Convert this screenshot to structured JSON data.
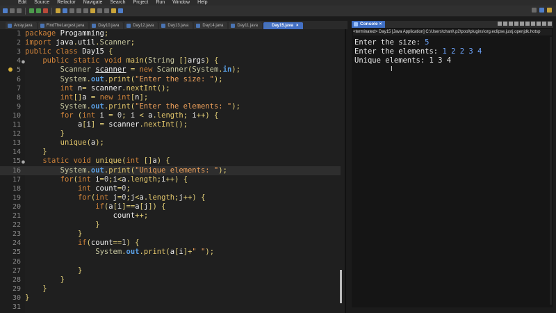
{
  "menu": [
    "Edit",
    "Source",
    "Refactor",
    "Navigate",
    "Search",
    "Project",
    "Run",
    "Window",
    "Help"
  ],
  "tabs": [
    "Array.java",
    "FindTheLargest.java",
    "Day10.java",
    "Day12.java",
    "Day13.java",
    "Day14.java",
    "Day11.java",
    "Day15.java"
  ],
  "active_tab_close": "×",
  "code_lines": [
    {
      "n": "1",
      "t": "package Progamming;"
    },
    {
      "n": "2",
      "t": "import java.util.Scanner;"
    },
    {
      "n": "3",
      "t": "public class Day15 {"
    },
    {
      "n": "4",
      "t": "    public static void main(String []args) {"
    },
    {
      "n": "5",
      "t": "        Scanner scanner = new Scanner(System.in);"
    },
    {
      "n": "6",
      "t": "        System.out.print(\"Enter the size: \");"
    },
    {
      "n": "7",
      "t": "        int n= scanner.nextInt();"
    },
    {
      "n": "8",
      "t": "        int[]a = new int[n];"
    },
    {
      "n": "9",
      "t": "        System.out.print(\"Enter the elements: \");"
    },
    {
      "n": "10",
      "t": "        for (int i = 0; i < a.length; i++) {"
    },
    {
      "n": "11",
      "t": "            a[i] = scanner.nextInt();"
    },
    {
      "n": "12",
      "t": "        }"
    },
    {
      "n": "13",
      "t": "        unique(a);"
    },
    {
      "n": "14",
      "t": "    }"
    },
    {
      "n": "15",
      "t": "    static void unique(int []a) {"
    },
    {
      "n": "16",
      "t": "        System.out.print(\"Unique elements: \");"
    },
    {
      "n": "17",
      "t": "        for(int i=0;i<a.length;i++) {"
    },
    {
      "n": "18",
      "t": "            int count=0;"
    },
    {
      "n": "19",
      "t": "            for(int j=0;j<a.length;j++) {"
    },
    {
      "n": "20",
      "t": "                if(a[i]==a[j]) {"
    },
    {
      "n": "21",
      "t": "                    count++;"
    },
    {
      "n": "22",
      "t": "                }"
    },
    {
      "n": "23",
      "t": "            }"
    },
    {
      "n": "24",
      "t": "            if(count==1) {"
    },
    {
      "n": "25",
      "t": "                System.out.print(a[i]+\" \");"
    },
    {
      "n": "26",
      "t": ""
    },
    {
      "n": "27",
      "t": "            }"
    },
    {
      "n": "28",
      "t": "        }"
    },
    {
      "n": "29",
      "t": "    }"
    },
    {
      "n": "30",
      "t": "}"
    },
    {
      "n": "31",
      "t": ""
    }
  ],
  "console": {
    "tab_label": "Console",
    "tab_close": "×",
    "status": "<terminated> Day15 [Java Application] C:\\Users\\chanl\\.p2\\pool\\plugins\\org.eclipse.justj.openjdk.hotsp",
    "lines": [
      {
        "label": "Enter the size: ",
        "value": "5"
      },
      {
        "label": "Enter the elements: ",
        "value": "1 2 2 3 4"
      },
      {
        "label": "Unique elements: 1 3 4",
        "value": ""
      }
    ],
    "cursor": "I"
  }
}
